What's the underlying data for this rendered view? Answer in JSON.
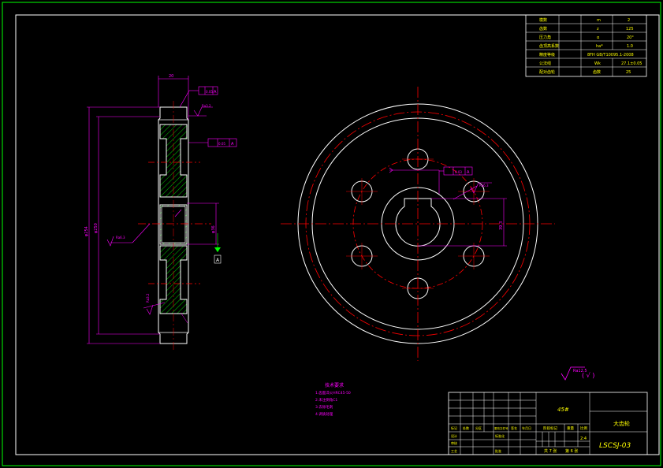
{
  "colors": {
    "background": "#000000",
    "outline": "#ffffff",
    "frame": "#00ff00",
    "centerline": "#ff0000",
    "dimension": "#ff00ff",
    "hatch": "#00ff00",
    "text_yellow": "#ffff00"
  },
  "param_table": {
    "rows": [
      {
        "name": "模数",
        "sym": "m",
        "val": "2"
      },
      {
        "name": "齿数",
        "sym": "z",
        "val": "125"
      },
      {
        "name": "压力角",
        "sym": "α",
        "val": "20°"
      },
      {
        "name": "齿顶高系数",
        "sym": "ha*",
        "val": "1.0"
      },
      {
        "name": "精度等级",
        "sym": "",
        "val": "8FH GB/T10095.1-2008"
      },
      {
        "name": "公法线",
        "sym": "Wk",
        "val": "27.1±0.05"
      },
      {
        "name": "配对齿轮",
        "sym": "齿数",
        "val": "25"
      }
    ]
  },
  "side_view": {
    "width_dim": "20",
    "tol_top": "0.05",
    "tol_mid": "0.05",
    "datum": "A",
    "dia_outer": "φ254",
    "dia_pitch": "φ250",
    "bore_dim": "φ36",
    "rough_hub": "Ra3.2",
    "rough_teeth": "Ra3.2",
    "rough_left": "Ra6.3"
  },
  "front_view": {
    "tol": "0.03",
    "datum": "A",
    "keyway_dim": "39.3",
    "rough_label": "Ra6.3"
  },
  "general_roughness": {
    "label": "Ra12.5",
    "paren": "( √ )"
  },
  "tech_notes": {
    "title": "技术要求",
    "lines": [
      "1.齿面淬火HRC45-50",
      "2.未注倒角C1",
      "3.去除毛刺",
      "4.调质处理"
    ]
  },
  "title_block": {
    "material": "45#",
    "part_name": "大齿轮",
    "drawing_no": "LSCSJ-03",
    "headers": [
      "标记",
      "处数",
      "分区",
      "更改文件号",
      "签名",
      "年月日"
    ],
    "roles": [
      "设计",
      "审核",
      "工艺"
    ],
    "standardize": "标准化",
    "approve": "批准",
    "stage_mark": "阶段标记",
    "weight": "重量",
    "scale": "比例",
    "scale_value": "2:4",
    "sheets_total": "共 7 张",
    "sheet_no": "第 6 张"
  }
}
